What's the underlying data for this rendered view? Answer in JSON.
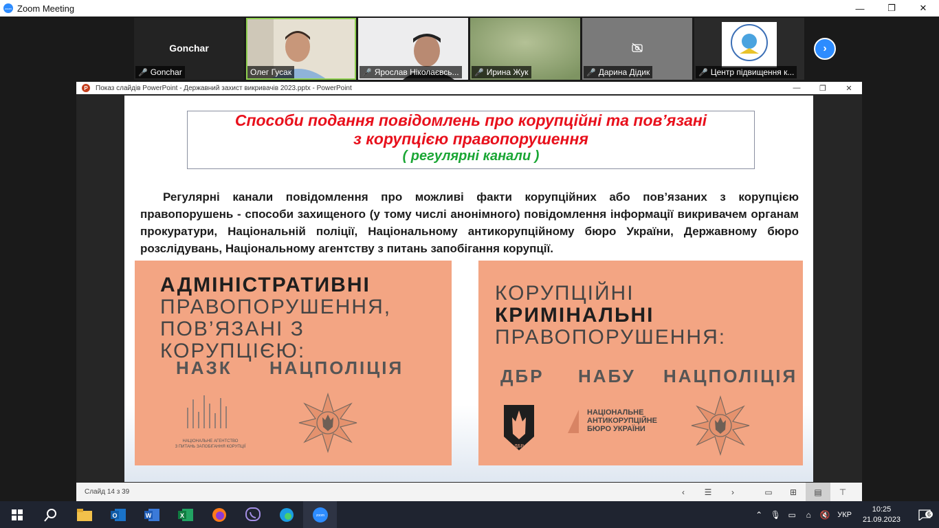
{
  "zoom": {
    "window_title": "Zoom Meeting",
    "controls": {
      "minimize": "—",
      "maximize": "❐",
      "close": "✕"
    },
    "participants": [
      {
        "display": "Gonchar",
        "name": "Gonchar",
        "muted": true,
        "video": false
      },
      {
        "name": "Олег Гусак",
        "muted": false,
        "video": true,
        "active": true
      },
      {
        "name": "Ярослав Ніколаєвсь...",
        "muted": true,
        "video": true
      },
      {
        "name": "Ирина Жук",
        "muted": true,
        "video": true
      },
      {
        "name": "Дарина Дідик",
        "muted": true,
        "video": false
      },
      {
        "name": "Центр підвищення к...",
        "muted": true,
        "video": true
      }
    ],
    "next_page_icon": "chevron-right-icon"
  },
  "powerpoint": {
    "window_title": "Показ слайдів PowerPoint  -  Державний захист викривачів 2023.pptx - PowerPoint",
    "status": {
      "slide_counter": "Слайд 14 з 39"
    },
    "slide": {
      "title_line1": "Способи подання повідомлень про корупційні та пов’язані",
      "title_line2": "з корупцією правопорушення",
      "subtitle": "( регулярні канали )",
      "body": "Регулярні канали повідомлення про можливі факти корупційних або пов’язаних з корупцією правопорушень - способи захищеного (у тому числі анонімного) повідомлення інформації викривачем органам прокуратури, Національній поліції, Національному антикорупційному бюро України, Державному бюро розслідувань, Національному агентству з питань запобігання корупції.",
      "left_card": {
        "line1": "АДМІНІСТРАТИВНІ",
        "line2": "ПРАВОПОРУШЕННЯ,",
        "line3": "ПОВ’ЯЗАНІ З КОРУПЦІЄЮ:",
        "agency1": "НАЗК",
        "agency2": "НАЦПОЛІЦІЯ",
        "nazk_caption_1": "НАЦІОНАЛЬНЕ АГЕНТСТВО",
        "nazk_caption_2": "З ПИТАНЬ ЗАПОБІГАННЯ КОРУПЦІЇ"
      },
      "right_card": {
        "line1": "КОРУПЦІЙНІ",
        "line2": "КРИМІНАЛЬНІ",
        "line3": "ПРАВОПОРУШЕННЯ:",
        "agency1": "ДБР",
        "agency2": "НАБУ",
        "agency3": "НАЦПОЛІЦІЯ",
        "dbr_mark": "ДБР",
        "nabu_1": "НАЦІОНАЛЬНЕ",
        "nabu_2": "АНТИКОРУПЦІЙНЕ",
        "nabu_3": "БЮРО УКРАЇНИ"
      },
      "colors": {
        "title": "#e8101c",
        "subtitle": "#1aa634",
        "card": "#f3a583"
      }
    }
  },
  "taskbar": {
    "language": "УКР",
    "time": "10:25",
    "date": "21.09.2023",
    "notifications": "6"
  }
}
